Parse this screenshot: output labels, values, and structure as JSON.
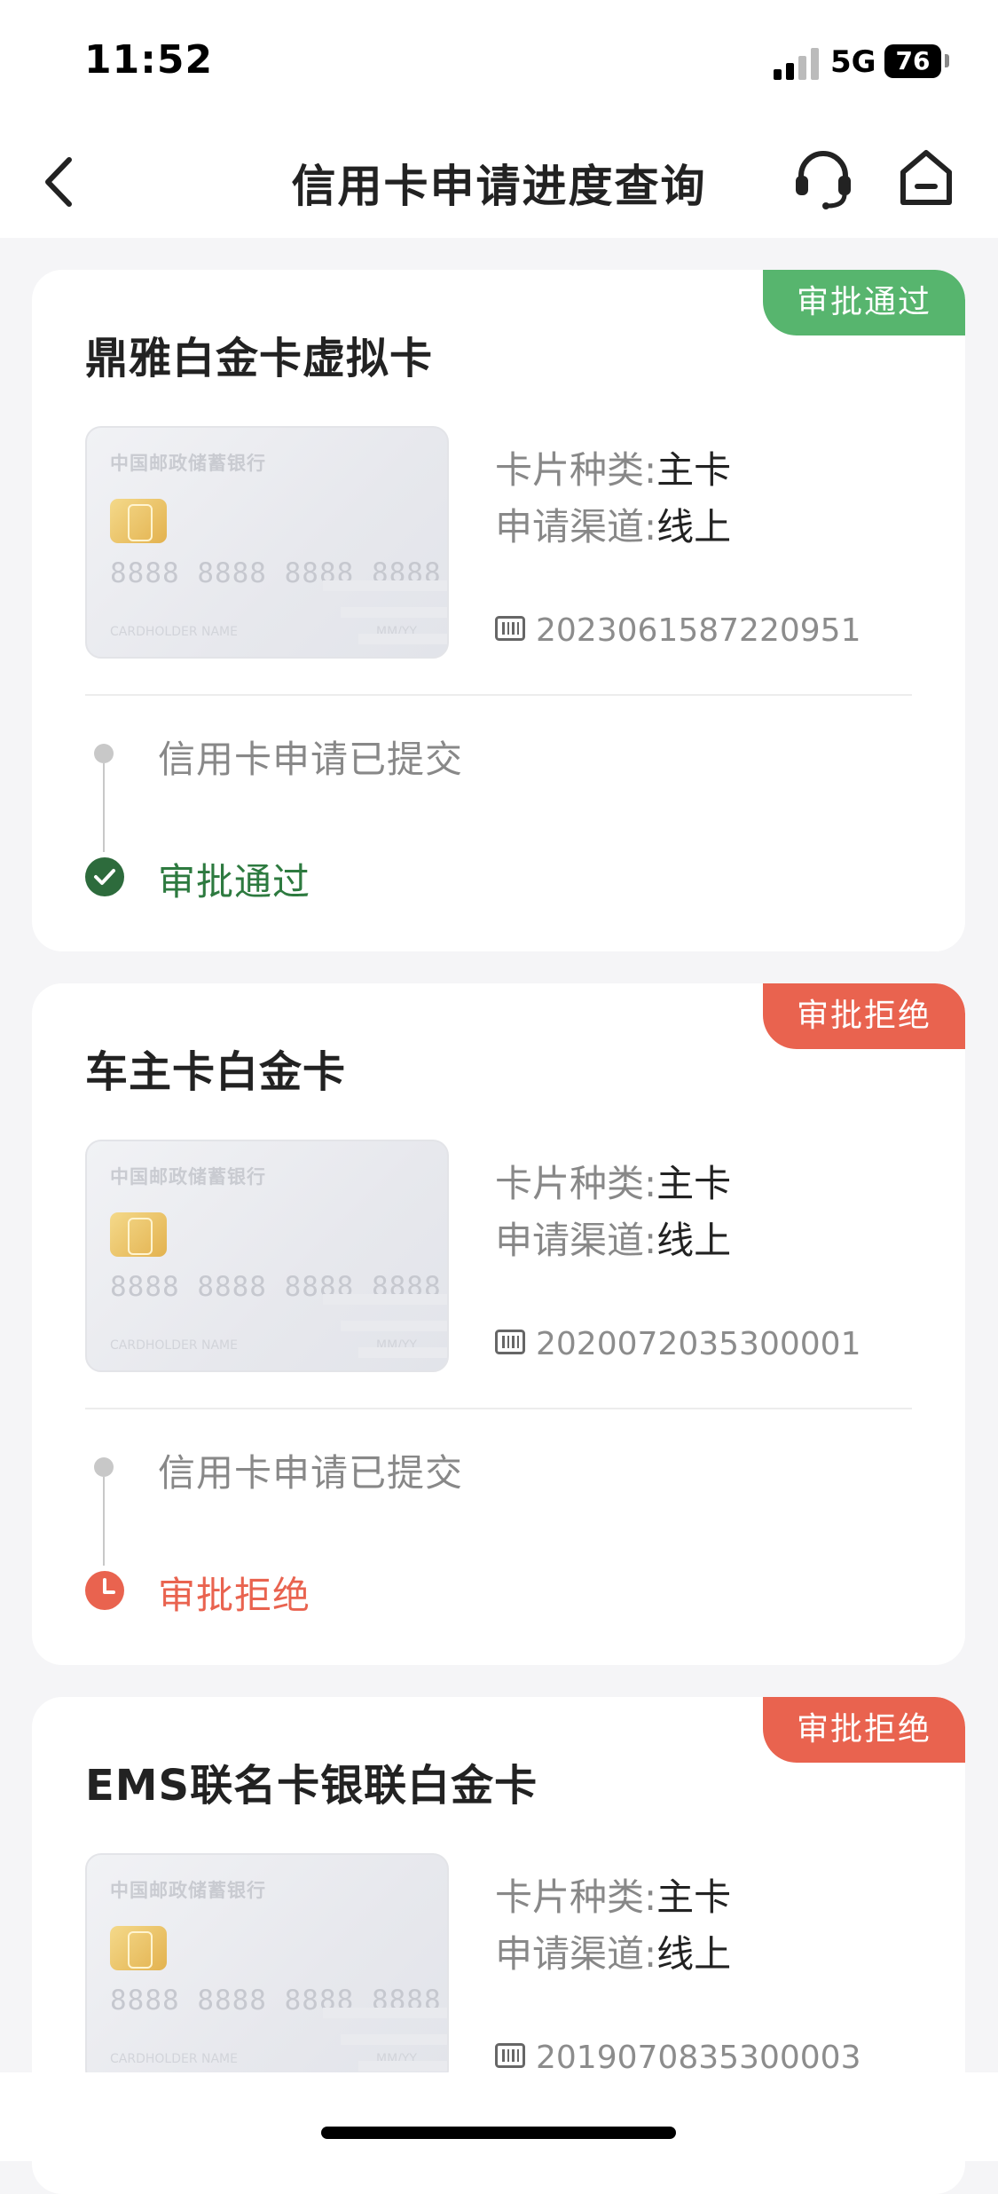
{
  "status_bar": {
    "time": "11:52",
    "network": "5G",
    "battery": "76"
  },
  "nav": {
    "title": "信用卡申请进度查询",
    "icons": [
      "back-icon",
      "headset-icon",
      "home-icon"
    ]
  },
  "colors": {
    "approved": "#57b56e",
    "rejected": "#e9634f",
    "approved_text": "#2d7a3f"
  },
  "card_placeholder": {
    "bank": "中国邮政储蓄银行",
    "number": "8888 8888 8888 8888",
    "holder": "CARDHOLDER NAME",
    "expiry": "MM/YY"
  },
  "applications": [
    {
      "status": "审批通过",
      "name": "鼎雅白金卡虚拟卡",
      "card_type_label": "卡片种类:",
      "card_type": "主卡",
      "channel_label": "申请渠道:",
      "channel": "线上",
      "serial": "2023061587220951",
      "steps": [
        "信用卡申请已提交",
        "审批通过"
      ]
    },
    {
      "status": "审批拒绝",
      "name": "车主卡白金卡",
      "card_type_label": "卡片种类:",
      "card_type": "主卡",
      "channel_label": "申请渠道:",
      "channel": "线上",
      "serial": "2020072035300001",
      "steps": [
        "信用卡申请已提交",
        "审批拒绝"
      ]
    },
    {
      "status": "审批拒绝",
      "name": "EMS联名卡银联白金卡",
      "card_type_label": "卡片种类:",
      "card_type": "主卡",
      "channel_label": "申请渠道:",
      "channel": "线上",
      "serial": "2019070835300003"
    }
  ]
}
